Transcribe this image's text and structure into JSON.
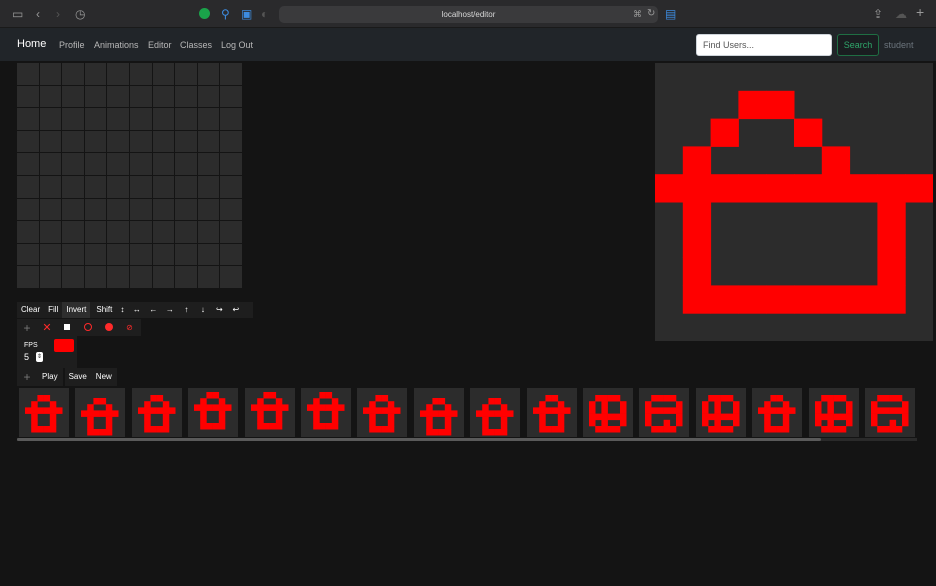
{
  "browser": {
    "url": "localhost/editor"
  },
  "nav": {
    "brand": "Home",
    "links": [
      "Profile",
      "Animations",
      "Editor",
      "Classes",
      "Log Out"
    ],
    "search_placeholder": "Find Users...",
    "search_label": "Search",
    "user": "student"
  },
  "editor": {
    "grid_size": 10,
    "pixel_color": "#ff0000",
    "preview_pixels": [
      "...##.....",
      "..#..#....",
      ".#....#...",
      "##########",
      ".#......#.",
      ".#......#.",
      ".#......#.",
      ".########."
    ]
  },
  "toolbar": {
    "clear": "Clear",
    "fill": "Fill",
    "invert": "Invert",
    "shift": "Shift"
  },
  "playback": {
    "fps_label": "FPS",
    "fps_value": "5",
    "play": "Play",
    "save": "Save",
    "new": "New"
  },
  "timeline": {
    "frame_count": 16,
    "frames": [
      {
        "shape": "house",
        "row_shift": 0
      },
      {
        "shape": "house",
        "row_shift": 1
      },
      {
        "shape": "house",
        "row_shift": 0
      },
      {
        "shape": "house",
        "row_shift": -1
      },
      {
        "shape": "house",
        "row_shift": -1
      },
      {
        "shape": "house",
        "row_shift": -1
      },
      {
        "shape": "house",
        "row_shift": 0
      },
      {
        "shape": "house",
        "row_shift": 1
      },
      {
        "shape": "house",
        "row_shift": 1
      },
      {
        "shape": "house",
        "row_shift": 0
      },
      {
        "shape": "circle-cross",
        "row_shift": 0
      },
      {
        "shape": "circle-b",
        "row_shift": 0
      },
      {
        "shape": "circle-cross",
        "row_shift": 0
      },
      {
        "shape": "house",
        "row_shift": 0
      },
      {
        "shape": "circle-cross",
        "row_shift": 0
      },
      {
        "shape": "circle-b",
        "row_shift": 0
      }
    ]
  }
}
